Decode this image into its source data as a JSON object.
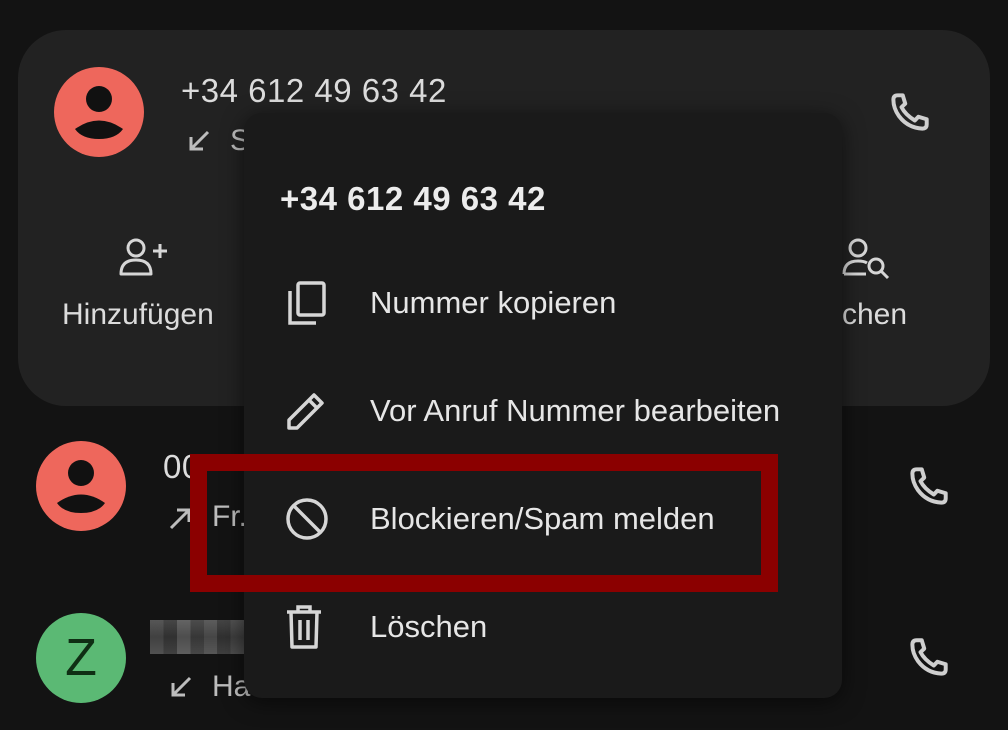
{
  "call_log": {
    "expanded_entry": {
      "number": "+34 612 49 63 42",
      "detail_partial": "S",
      "call_direction": "incoming",
      "avatar_color": "#ee675c",
      "actions": [
        {
          "label": "Hinzufügen",
          "icon": "person-add-icon"
        },
        {
          "label": "chen",
          "icon": "person-search-icon"
        }
      ]
    },
    "entries": [
      {
        "number_partial": "00",
        "detail_partial": "Fr.",
        "call_direction": "outgoing",
        "avatar_color": "#ee675c"
      },
      {
        "avatar_letter": "Z",
        "detail_partial": "Ha",
        "call_direction": "incoming",
        "avatar_color": "#5bb974"
      }
    ]
  },
  "context_menu": {
    "title": "+34 612 49 63 42",
    "items": [
      {
        "label": "Nummer kopieren",
        "icon": "copy-icon"
      },
      {
        "label": "Vor Anruf Nummer bearbeiten",
        "icon": "pencil-icon"
      },
      {
        "label": "Blockieren/Spam melden",
        "icon": "block-icon"
      },
      {
        "label": "Löschen",
        "icon": "trash-icon"
      }
    ],
    "highlighted_item": "Blockieren/Spam melden",
    "highlight_color": "#8b0000"
  }
}
